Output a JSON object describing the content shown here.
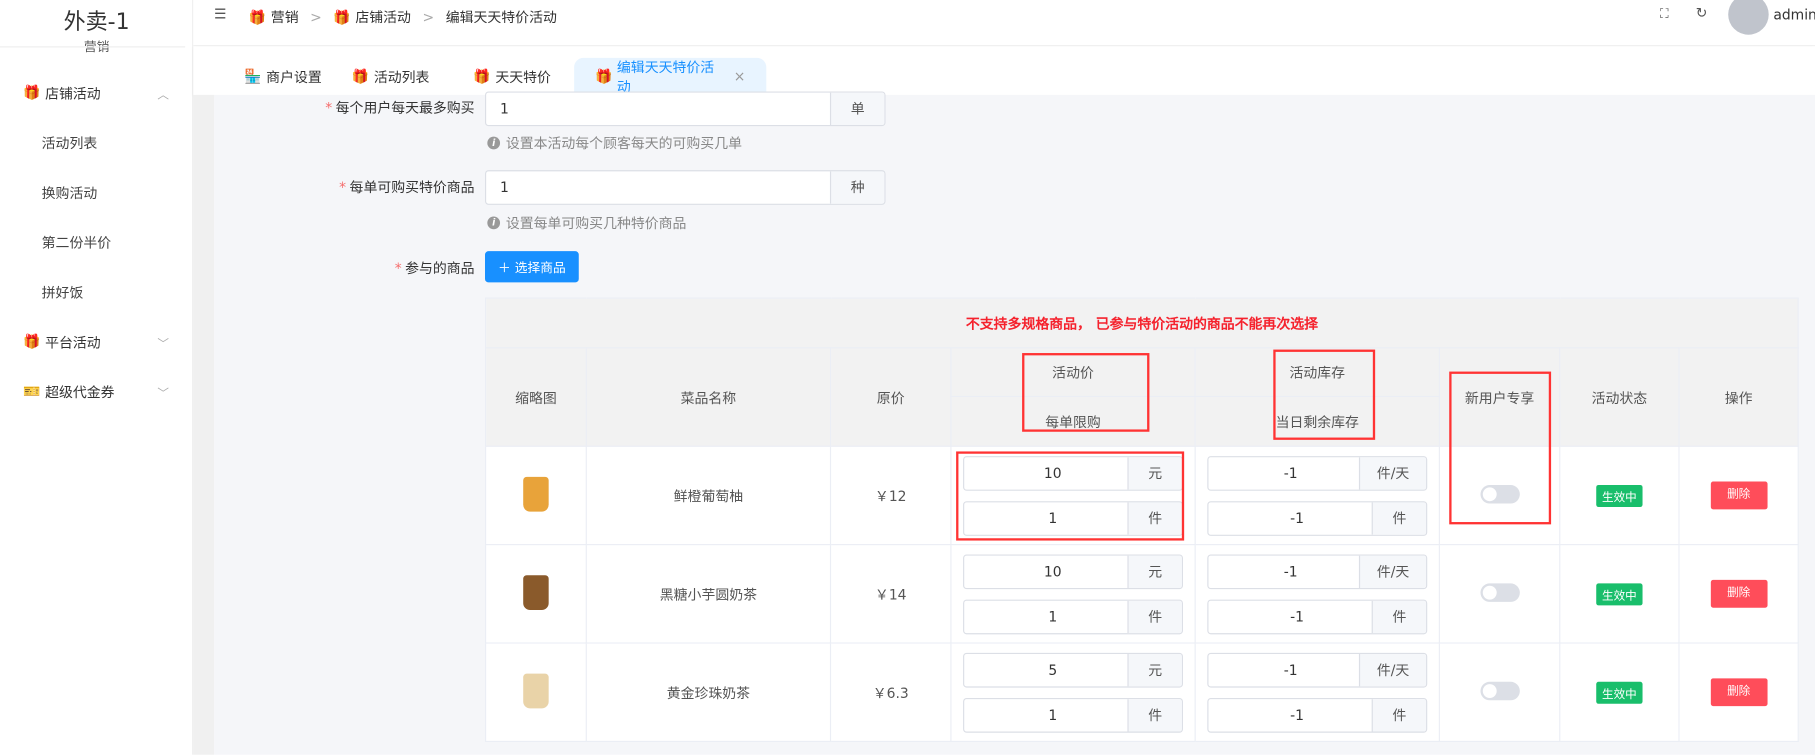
{
  "sidebar": {
    "logo": "外卖-1",
    "section": "营销",
    "menus": [
      {
        "label": "店铺活动",
        "icon": "shop-gift-icon",
        "expanded": true,
        "children": [
          "活动列表",
          "换购活动",
          "第二份半价",
          "拼好饭"
        ]
      },
      {
        "label": "平台活动",
        "icon": "gift-icon",
        "expanded": false
      },
      {
        "label": "超级代金券",
        "icon": "ticket-icon",
        "expanded": false
      }
    ]
  },
  "header": {
    "breadcrumb": [
      "营销",
      "店铺活动",
      "编辑天天特价活动"
    ],
    "user": "admin"
  },
  "tabs": [
    {
      "label": "商户设置"
    },
    {
      "label": "活动列表"
    },
    {
      "label": "天天特价"
    },
    {
      "label": "编辑天天特价活动",
      "active": true,
      "close": "×"
    }
  ],
  "form": {
    "max_per_day": {
      "label": "每个用户每天最多购买",
      "value": "1",
      "unit": "单",
      "hint": "设置本活动每个顾客每天的可购买几单"
    },
    "per_order": {
      "label": "每单可购买特价商品",
      "value": "1",
      "unit": "种",
      "hint": "设置每单可购买几种特价商品"
    },
    "goods": {
      "label": "参与的商品",
      "button": "＋ 选择商品"
    }
  },
  "table": {
    "notice": "不支持多规格商品， 已参与特价活动的商品不能再次选择",
    "headers": {
      "thumb": "缩略图",
      "name": "菜品名称",
      "price": "原价",
      "act_price": "活动价",
      "limit": "每单限购",
      "stock": "活动库存",
      "remain": "当日剩余库存",
      "new_user": "新用户专享",
      "status": "活动状态",
      "op": "操作"
    },
    "rows": [
      {
        "name": "鲜橙葡萄柚",
        "price": "￥12",
        "act_price": "10",
        "price_unit": "元",
        "limit": "1",
        "limit_unit": "件",
        "stock": "-1",
        "stock_unit": "件/天",
        "remain": "-1",
        "remain_unit": "件",
        "new_user": false,
        "status": "生效中",
        "op": "删除",
        "thumb_color": "#e8a33a"
      },
      {
        "name": "黑糖小芋圆奶茶",
        "price": "￥14",
        "act_price": "10",
        "price_unit": "元",
        "limit": "1",
        "limit_unit": "件",
        "stock": "-1",
        "stock_unit": "件/天",
        "remain": "-1",
        "remain_unit": "件",
        "new_user": false,
        "status": "生效中",
        "op": "删除",
        "thumb_color": "#8a5a2b"
      },
      {
        "name": "黄金珍珠奶茶",
        "price": "￥6.3",
        "act_price": "5",
        "price_unit": "元",
        "limit": "1",
        "limit_unit": "件",
        "stock": "-1",
        "stock_unit": "件/天",
        "remain": "-1",
        "remain_unit": "件",
        "new_user": false,
        "status": "生效中",
        "op": "删除",
        "thumb_color": "#e9d3a8"
      }
    ]
  }
}
